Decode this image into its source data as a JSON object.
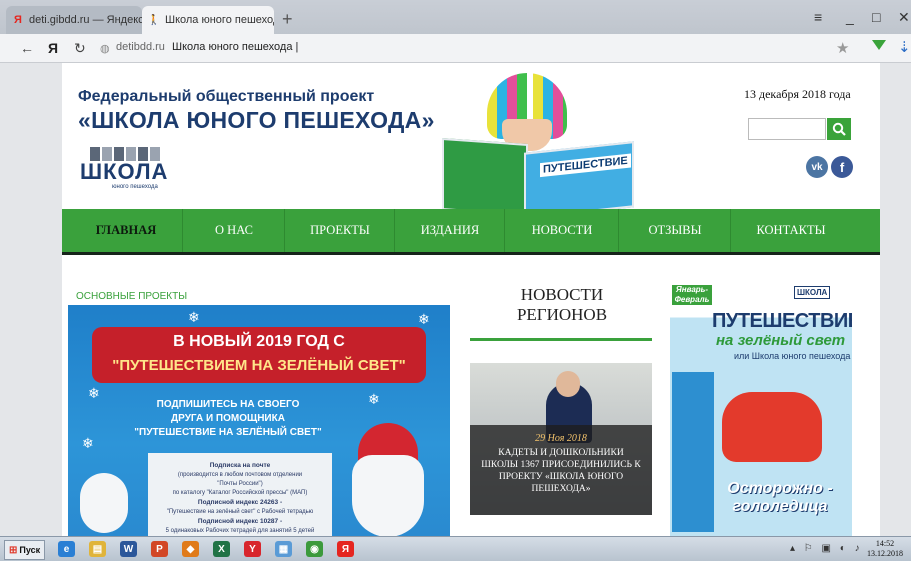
{
  "browser": {
    "tabs": [
      {
        "label": "deti.gibdd.ru — Яндекс: на",
        "favicon": "yandex-icon",
        "active": false
      },
      {
        "label": "Школа юного пешехода",
        "favicon": "pedestrian-icon",
        "active": true
      }
    ],
    "close_glyph": "×",
    "new_tab_glyph": "+",
    "window_controls": {
      "menu": "≡",
      "minimize": "_",
      "maximize": "□",
      "close": "✕"
    },
    "address": {
      "back": "←",
      "logo": "Я",
      "reload": "↻",
      "domain": "detibdd.ru",
      "title": "Школа юного пешехода |"
    },
    "star_glyph": "★"
  },
  "header": {
    "project_line1": "Федеральный общественный проект",
    "project_line2": "«ШКОЛА ЮНОГО ПЕШЕХОДА»",
    "logo_word": "ШКОЛА",
    "logo_sub": "юного пешехода",
    "hero_book_title": "ПУТЕШЕСТВИЕ",
    "date": "13 декабря 2018 года",
    "search": {
      "value": "",
      "button_glyph": "🔍"
    },
    "social": {
      "vk": "vk",
      "fb": "f"
    }
  },
  "nav": {
    "items": [
      {
        "label": "ГЛАВНАЯ",
        "active": true
      },
      {
        "label": "О НАС",
        "active": false
      },
      {
        "label": "ПРОЕКТЫ",
        "active": false
      },
      {
        "label": "ИЗДАНИЯ",
        "active": false
      },
      {
        "label": "НОВОСТИ",
        "active": false
      },
      {
        "label": "ОТЗЫВЫ",
        "active": false
      },
      {
        "label": "КОНТАКТЫ",
        "active": false
      }
    ]
  },
  "main": {
    "section_tag": "ОСНОВНЫЕ ПРОЕКТЫ",
    "banner": {
      "line1": "В НОВЫЙ 2019 ГОД С",
      "line2": "\"ПУТЕШЕСТВИЕМ НА ЗЕЛЁНЫЙ СВЕТ\"",
      "sub1": "ПОДПИШИТЕСЬ НА СВОЕГО",
      "sub2": "ДРУГА И ПОМОЩНИКА",
      "sub3": "\"ПУТЕШЕСТВИЕ НА ЗЕЛЁНЫЙ СВЕТ\"",
      "card_title": "Подписка на почте",
      "card_l1": "(производится в любом почтовом отделении",
      "card_l2": "\"Почты России\")",
      "card_l3": "по каталогу \"Каталог Российской прессы\" (МАП)",
      "card_l4": "Подписной индекс 24263 -",
      "card_l5": "\"Путешествие на зелёный свет\" с Рабочей тетрадью",
      "card_l6": "Подписной индекс 10287 -",
      "card_l7": "5 одинаковых Рабочих тетрадей для занятий 5 детей"
    },
    "news": {
      "heading_l1": "НОВОСТИ",
      "heading_l2": "РЕГИОНОВ",
      "date": "29 Ноя 2018",
      "text": "КАДЕТЫ И ДОШКОЛЬНИКИ ШКОЛЫ 1367 ПРИСОЕДИНИЛИСЬ К ПРОЕКТУ «ШКОЛА ЮНОГО ПЕШЕХОДА»"
    },
    "magazine": {
      "month": "Январь-Февраль",
      "logo": "ШКОЛА",
      "title1": "ПУТЕШЕСТВИЕ",
      "title2": "на зелёный свет",
      "title3": "или Школа юного пешехода",
      "bottom_l1": "Осторожно -",
      "bottom_l2": "гололедица"
    }
  },
  "taskbar": {
    "start_label": "Пуск",
    "apps": [
      {
        "icon": "ie-icon",
        "glyph": "e",
        "color": "#2a7fd4"
      },
      {
        "icon": "explorer-icon",
        "glyph": "▤",
        "color": "#e0b43a"
      },
      {
        "icon": "word-icon",
        "glyph": "W",
        "color": "#2b579a"
      },
      {
        "icon": "powerpoint-icon",
        "glyph": "P",
        "color": "#d24726"
      },
      {
        "icon": "media-icon",
        "glyph": "◆",
        "color": "#e07b1a"
      },
      {
        "icon": "excel-icon",
        "glyph": "X",
        "color": "#217346"
      },
      {
        "icon": "yandex-browser-icon",
        "glyph": "Y",
        "color": "#d8262c"
      },
      {
        "icon": "folder-icon",
        "glyph": "▦",
        "color": "#5a9bd6"
      },
      {
        "icon": "chrome-icon",
        "glyph": "◉",
        "color": "#3c9a3c"
      },
      {
        "icon": "yandex-icon",
        "glyph": "Я",
        "color": "#e52620"
      }
    ],
    "clock_time": "14:52",
    "clock_date": "13.12.2018"
  }
}
